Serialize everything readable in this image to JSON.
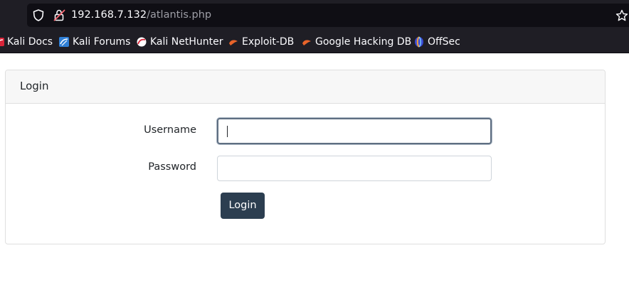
{
  "browser": {
    "url_host": "192.168.7.132",
    "url_path": "/atlantis.php",
    "bookmarks": [
      {
        "label": "Kali Docs",
        "icon": "kali-dragon-icon"
      },
      {
        "label": "Kali Forums",
        "icon": "kali-dragon-icon"
      },
      {
        "label": "Kali NetHunter",
        "icon": "kali-nethunter-icon"
      },
      {
        "label": "Exploit-DB",
        "icon": "exploit-db-icon"
      },
      {
        "label": "Google Hacking DB",
        "icon": "ghdb-icon"
      },
      {
        "label": "OffSec",
        "icon": "offsec-icon"
      }
    ]
  },
  "login": {
    "title": "Login",
    "username_label": "Username",
    "username_value": "",
    "password_label": "Password",
    "password_value": "",
    "submit_label": "Login"
  }
}
